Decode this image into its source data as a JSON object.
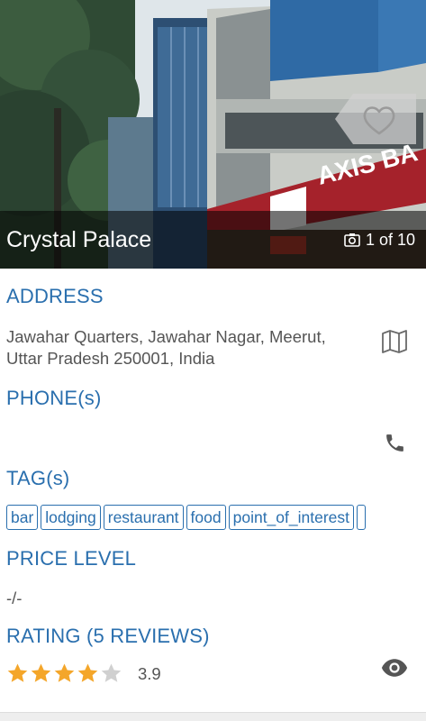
{
  "place": {
    "name": "Crystal Palace",
    "photo_counter": "1 of 10"
  },
  "address": {
    "label": "ADDRESS",
    "line1": "Jawahar Quarters, Jawahar Nagar, Meerut,",
    "line2": "Uttar Pradesh 250001, India",
    "icon": "map-icon"
  },
  "phone": {
    "label": "PHONE(s)",
    "icon": "phone-icon"
  },
  "tags": {
    "label": "TAG(s)",
    "items": [
      "bar",
      "lodging",
      "restaurant",
      "food",
      "point_of_interest"
    ]
  },
  "price": {
    "label": "PRICE LEVEL",
    "value": "-/-"
  },
  "rating": {
    "label": "RATING (5 REVIEWS)",
    "value": "3.9",
    "stars_filled": 4,
    "stars_total": 5,
    "icon": "eye-icon"
  },
  "hero_sign": {
    "text": "AXIS BA"
  },
  "colors": {
    "accent": "#2a6fae",
    "text": "#555555",
    "star": "#f4a62a",
    "star_empty": "#d0d0d0"
  }
}
